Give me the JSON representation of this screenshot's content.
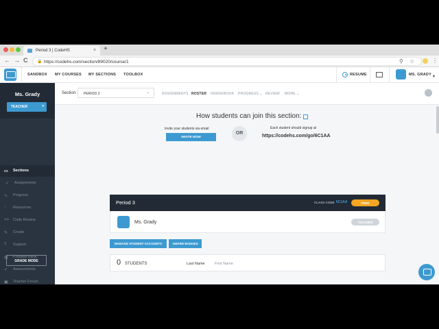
{
  "browser": {
    "tab_title": "Period 3 | CodeHS",
    "tab_close": "×",
    "new_tab": "+",
    "url": "https://codehs.com/section/89020/course/1",
    "lock": "🔒",
    "back": "←",
    "forward": "→",
    "reload": "C",
    "zoom": "⚲",
    "star": "☆",
    "menu": "⋮"
  },
  "site_nav": {
    "links": [
      "SANDBOX",
      "MY COURSES",
      "MY SECTIONS",
      "TOOLBOX"
    ],
    "resume": "RESUME",
    "user": "MS. GRADY",
    "user_chevron": "▾"
  },
  "sidebar": {
    "name": "Ms. Grady",
    "role": "TEACHER",
    "role_chevron": "▾",
    "items": [
      {
        "label": "Sections",
        "icon": "▭"
      },
      {
        "label": "Assignments",
        "icon": "✓"
      },
      {
        "label": "Progress",
        "icon": "∿"
      },
      {
        "label": "Resources",
        "icon": "◌"
      },
      {
        "label": "Code Review",
        "icon": "<>"
      },
      {
        "label": "Create",
        "icon": "✎"
      },
      {
        "label": "Support",
        "icon": "?"
      },
      {
        "label": "Problem Bank",
        "icon": "▤"
      },
      {
        "label": "Assessments",
        "icon": "✓"
      },
      {
        "label": "Teacher Forum",
        "icon": "▣"
      }
    ],
    "grade_mode": "GRADE MODE"
  },
  "subnav": {
    "section_label": "Section:",
    "section_value": "PERIOD 3",
    "section_chevron": "⌄",
    "tabs": [
      "ASSIGNMENTS",
      "ROSTER",
      "GRADEBOOK",
      "PROGRESS ⌄",
      "REVIEW",
      "MORE ⌄"
    ]
  },
  "join": {
    "title": "How students can join this section:",
    "invite_text": "Invite your students via email",
    "invite_button": "INVITE NOW",
    "or": "OR",
    "signup_text": "Each student should signup at",
    "signup_url": "https://codehs.com/go/6C1AA"
  },
  "section_card": {
    "title": "Period 3",
    "class_code_label": "CLASS CODE",
    "class_code": "6C1AA",
    "plan": "FREE",
    "teacher_name": "Ms. Grady",
    "teacher_role": "TEACHER"
  },
  "actions": {
    "manage": "MANAGE STUDENT ACCOUNTS",
    "badges": "AWARD BADGES"
  },
  "students": {
    "count": "0",
    "label": "STUDENTS",
    "col_last": "Last Name",
    "col_first": "First Name"
  },
  "colors": {
    "accent": "#3d9ad1",
    "sidebar": "#2a3441",
    "header_dark": "#222b35",
    "free_badge": "#f5a623"
  }
}
